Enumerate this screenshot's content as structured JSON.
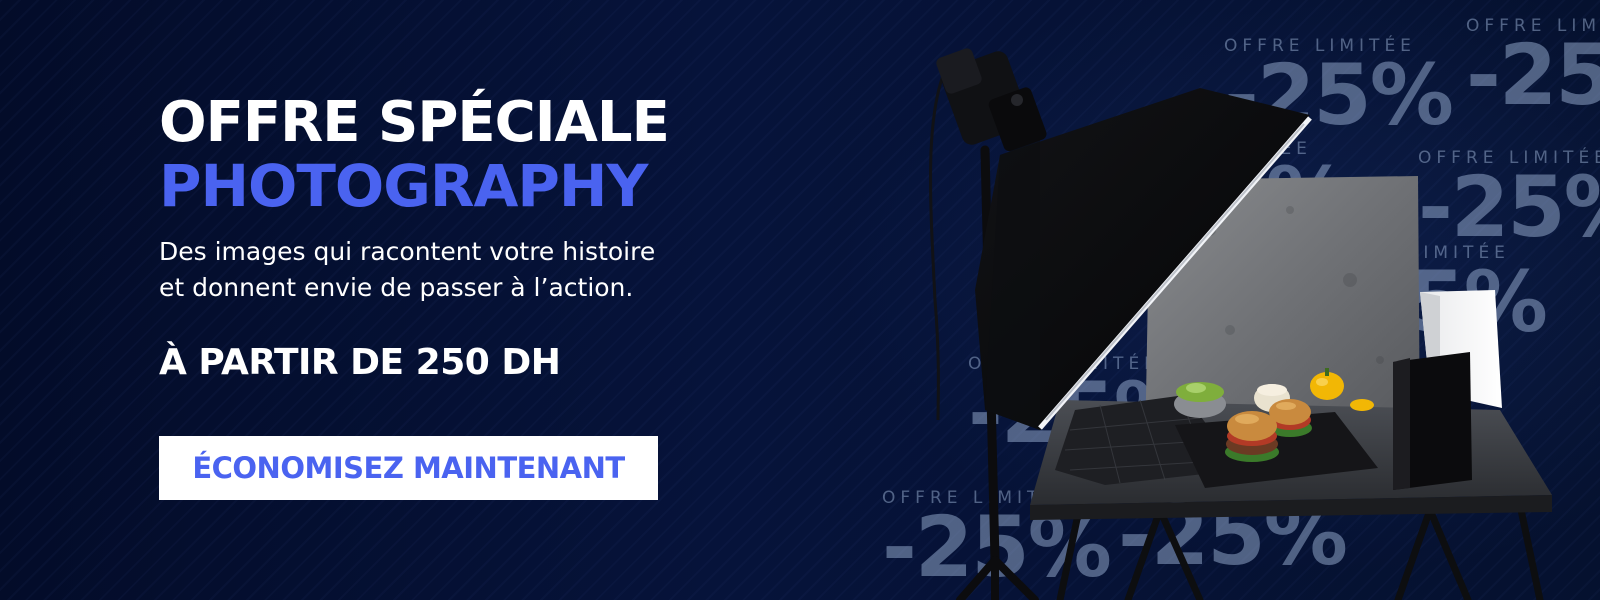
{
  "banner": {
    "headline": "OFFRE SPÉCIALE",
    "subheadline": "PHOTOGRAPHY",
    "description_lines": [
      "Des images qui racontent votre histoire",
      "et donnent envie de passer à l’action."
    ],
    "price_text": "À PARTIR DE 250 DH",
    "cta_label": "ÉCONOMISEZ MAINTENANT"
  },
  "watermark": {
    "caption": "OFFRE LIMITÉE",
    "discount": "-25%"
  },
  "illustration": {
    "subject": "photo-studio-softbox-food-setup"
  },
  "colors": {
    "background": "#030c29",
    "accent": "#4a63f0",
    "text": "#ffffff",
    "watermark": "#96aacd"
  }
}
